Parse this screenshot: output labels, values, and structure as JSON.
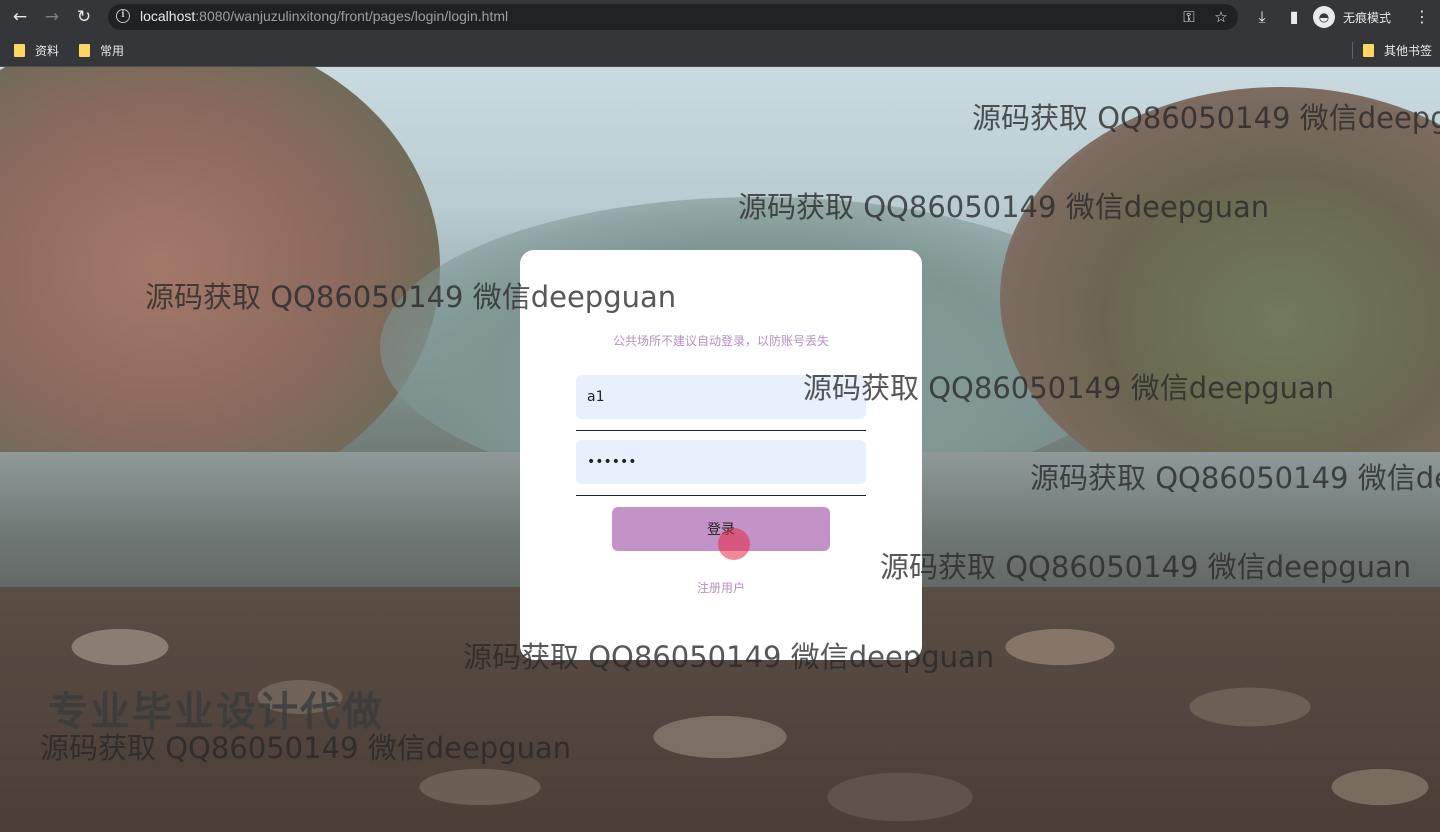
{
  "browser": {
    "url_host": "localhost",
    "url_rest": ":8080/wanjuzulinxitong/front/pages/login/login.html",
    "incognito_label": "无痕模式",
    "bookmarks": [
      "资料",
      "常用"
    ],
    "other_bookmarks": "其他书签"
  },
  "login": {
    "hint": "公共场所不建议自动登录，以防账号丢失",
    "username_value": "a1",
    "password_value": "123456",
    "login_label": "登录",
    "register_label": "注册用户"
  },
  "watermarks": {
    "text": "源码获取 QQ86050149 微信deepguan",
    "promo": "专业毕业设计代做"
  }
}
